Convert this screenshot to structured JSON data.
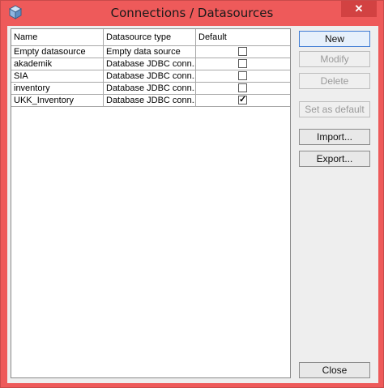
{
  "window": {
    "title": "Connections / Datasources",
    "close_glyph": "✕",
    "icon": "cube-icon",
    "accent_color": "#ee5a5a"
  },
  "table": {
    "columns": [
      "Name",
      "Datasource type",
      "Default"
    ],
    "rows": [
      {
        "name": "Empty datasource",
        "type": "Empty data source",
        "default": false
      },
      {
        "name": "akademik",
        "type": "Database JDBC conn...",
        "default": false
      },
      {
        "name": "SIA",
        "type": "Database JDBC conn...",
        "default": false
      },
      {
        "name": "inventory",
        "type": "Database JDBC conn...",
        "default": false
      },
      {
        "name": "UKK_Inventory",
        "type": "Database JDBC conn...",
        "default": true
      }
    ]
  },
  "buttons": {
    "new": "New",
    "modify": "Modify",
    "delete": "Delete",
    "set_default": "Set as default",
    "import": "Import...",
    "export": "Export...",
    "close": "Close"
  },
  "check_glyph": "✓"
}
